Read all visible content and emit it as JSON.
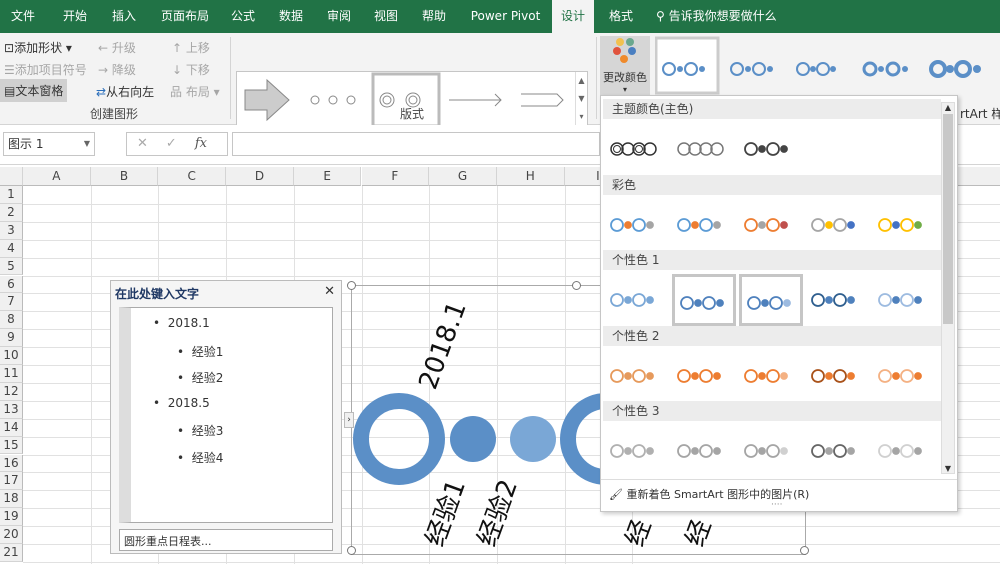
{
  "tabs": [
    "文件",
    "开始",
    "插入",
    "页面布局",
    "公式",
    "数据",
    "审阅",
    "视图",
    "帮助",
    "Power Pivot",
    "设计",
    "格式"
  ],
  "search_placeholder": "告诉我你想要做什么",
  "ribbon": {
    "add_shape": "添加形状",
    "add_bullet": "添加项目符号",
    "text_pane": "文本窗格",
    "promote": "升级",
    "demote": "降级",
    "right_to_left": "从右向左",
    "move_up": "上移",
    "move_down": "下移",
    "layout": "布局",
    "group_create": "创建图形",
    "group_layouts": "版式",
    "change_colors": "更改颜色",
    "styles_label": "rtArt 样"
  },
  "namebox": "图示 1",
  "columns": [
    "A",
    "B",
    "C",
    "D",
    "E",
    "F",
    "G",
    "H",
    "I"
  ],
  "rows": [
    "1",
    "2",
    "3",
    "4",
    "5",
    "6",
    "7",
    "8",
    "9",
    "10",
    "11",
    "12",
    "13",
    "14",
    "15",
    "16",
    "17",
    "18",
    "19",
    "20",
    "21"
  ],
  "text_pane": {
    "title": "在此处键入文字",
    "items": [
      {
        "t": "2018.1",
        "l": 1
      },
      {
        "t": "经验1",
        "l": 2
      },
      {
        "t": "经验2",
        "l": 2
      },
      {
        "t": "2018.5",
        "l": 1
      },
      {
        "t": "经验3",
        "l": 2
      },
      {
        "t": "经验4",
        "l": 2
      }
    ],
    "footer": "圆形重点日程表..."
  },
  "smartart": {
    "date1": "2018.1",
    "exp1": "经验1",
    "exp2": "经验2",
    "exp3": "经",
    "exp4": "经",
    "color": "#5b8fc7"
  },
  "dropdown": {
    "sections": [
      {
        "title": "主题颜色(主色)",
        "options": [
          [
            "#333",
            "#333",
            "#333",
            "#333"
          ],
          [
            "#777",
            "#777",
            "#777",
            "#777"
          ],
          [
            "#444",
            "#444",
            "#444",
            "#444"
          ]
        ]
      },
      {
        "title": "彩色",
        "options": [
          [
            "#5b9bd5",
            "#ed7d31",
            "#5b9bd5",
            "#a5a5a5"
          ],
          [
            "#5b9bd5",
            "#ed7d31",
            "#5b9bd5",
            "#a5a5a5"
          ],
          [
            "#ed7d31",
            "#a5a5a5",
            "#ed7d31",
            "#c0504d"
          ],
          [
            "#a5a5a5",
            "#ffc000",
            "#a5a5a5",
            "#4472c4"
          ],
          [
            "#ffc000",
            "#4472c4",
            "#ffc000",
            "#70ad47"
          ]
        ]
      },
      {
        "title": "个性色 1",
        "options": [
          [
            "#7aa7d6",
            "#7aa7d6",
            "#7aa7d6",
            "#7aa7d6"
          ],
          [
            "#4f81bd",
            "#4f81bd",
            "#4f81bd",
            "#4f81bd"
          ],
          [
            "#4f81bd",
            "#4f81bd",
            "#4f81bd",
            "#9dbbe0"
          ],
          [
            "#2f5f8f",
            "#4f81bd",
            "#2f5f8f",
            "#4f81bd"
          ],
          [
            "#9dbbe0",
            "#4f81bd",
            "#9dbbe0",
            "#4f81bd"
          ]
        ]
      },
      {
        "title": "个性色 2",
        "options": [
          [
            "#e69a5c",
            "#e69a5c",
            "#e69a5c",
            "#e69a5c"
          ],
          [
            "#ed7d31",
            "#ed7d31",
            "#ed7d31",
            "#ed7d31"
          ],
          [
            "#ed7d31",
            "#ed7d31",
            "#ed7d31",
            "#f4b183"
          ],
          [
            "#a9521a",
            "#ed7d31",
            "#a9521a",
            "#ed7d31"
          ],
          [
            "#f4b183",
            "#ed7d31",
            "#f4b183",
            "#ed7d31"
          ]
        ]
      },
      {
        "title": "个性色 3",
        "options": [
          [
            "#b0b0b0",
            "#b0b0b0",
            "#b0b0b0",
            "#b0b0b0"
          ],
          [
            "#a5a5a5",
            "#a5a5a5",
            "#a5a5a5",
            "#a5a5a5"
          ],
          [
            "#a5a5a5",
            "#a5a5a5",
            "#a5a5a5",
            "#d0d0d0"
          ],
          [
            "#666",
            "#a5a5a5",
            "#666",
            "#a5a5a5"
          ],
          [
            "#d0d0d0",
            "#a5a5a5",
            "#d0d0d0",
            "#a5a5a5"
          ]
        ]
      }
    ],
    "recolor": "重新着色 SmartArt 图形中的图片(R)"
  }
}
